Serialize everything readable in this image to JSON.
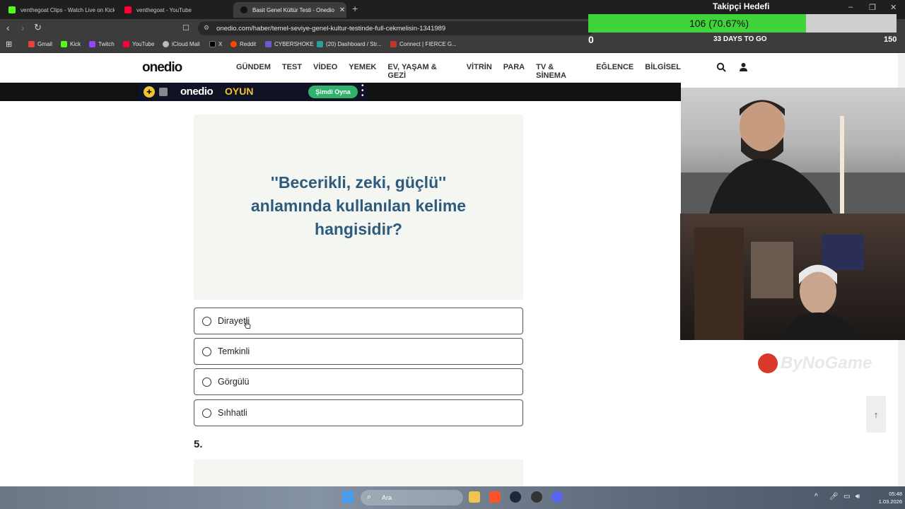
{
  "browser": {
    "tabs": [
      {
        "title": "venthegoat Clips - Watch Live on Kick",
        "active": false
      },
      {
        "title": "venthegoat - YouTube",
        "active": false
      },
      {
        "title": "Basit Genel Kültür Testi - Onedio",
        "active": true
      }
    ],
    "url": "onedio.com/haber/temel-seviye-genel-kultur-testinde-full-cekmelisin-1341989",
    "bookmarks": [
      "Gmail",
      "Kick",
      "Twitch",
      "YouTube",
      "iCloud Mail",
      "X",
      "Reddit",
      "CYBERSHOKE",
      "(20) Dashboard / Str...",
      "Connect | FIERCE G..."
    ]
  },
  "site": {
    "logo": "onedio",
    "menu": [
      "GÜNDEM",
      "TEST",
      "VİDEO",
      "YEMEK",
      "EV, YAŞAM & GEZİ",
      "VİTRİN",
      "PARA",
      "TV & SİNEMA",
      "EĞLENCE",
      "BİLGİSEL"
    ],
    "promo": {
      "logo": "onedio",
      "game": "OYUN",
      "button": "Şimdi Oyna"
    }
  },
  "quiz": {
    "question": "''Becerikli, zeki, güçlü'' anlamında kullanılan kelime hangisidir?",
    "options": [
      "Dirayetli",
      "Temkinli",
      "Görgülü",
      "Sıhhatli"
    ],
    "next_number": "5."
  },
  "overlay": {
    "goal_title": "Takipçi Hedefi",
    "goal_value": "106 (70.67%)",
    "goal_progress": 0.7067,
    "goal_min": "0",
    "goal_max": "150",
    "goal_days": "33 DAYS TO GO",
    "brand": "ByNoGame"
  },
  "taskbar": {
    "search_placeholder": "Ara",
    "time": "05:48",
    "date": "1.03.2026"
  },
  "colors": {
    "question_text": "#2e5a7e",
    "question_bg": "#f4f7f1",
    "goal_fill": "#3fd43b",
    "promo_button": "#2fb26b"
  }
}
